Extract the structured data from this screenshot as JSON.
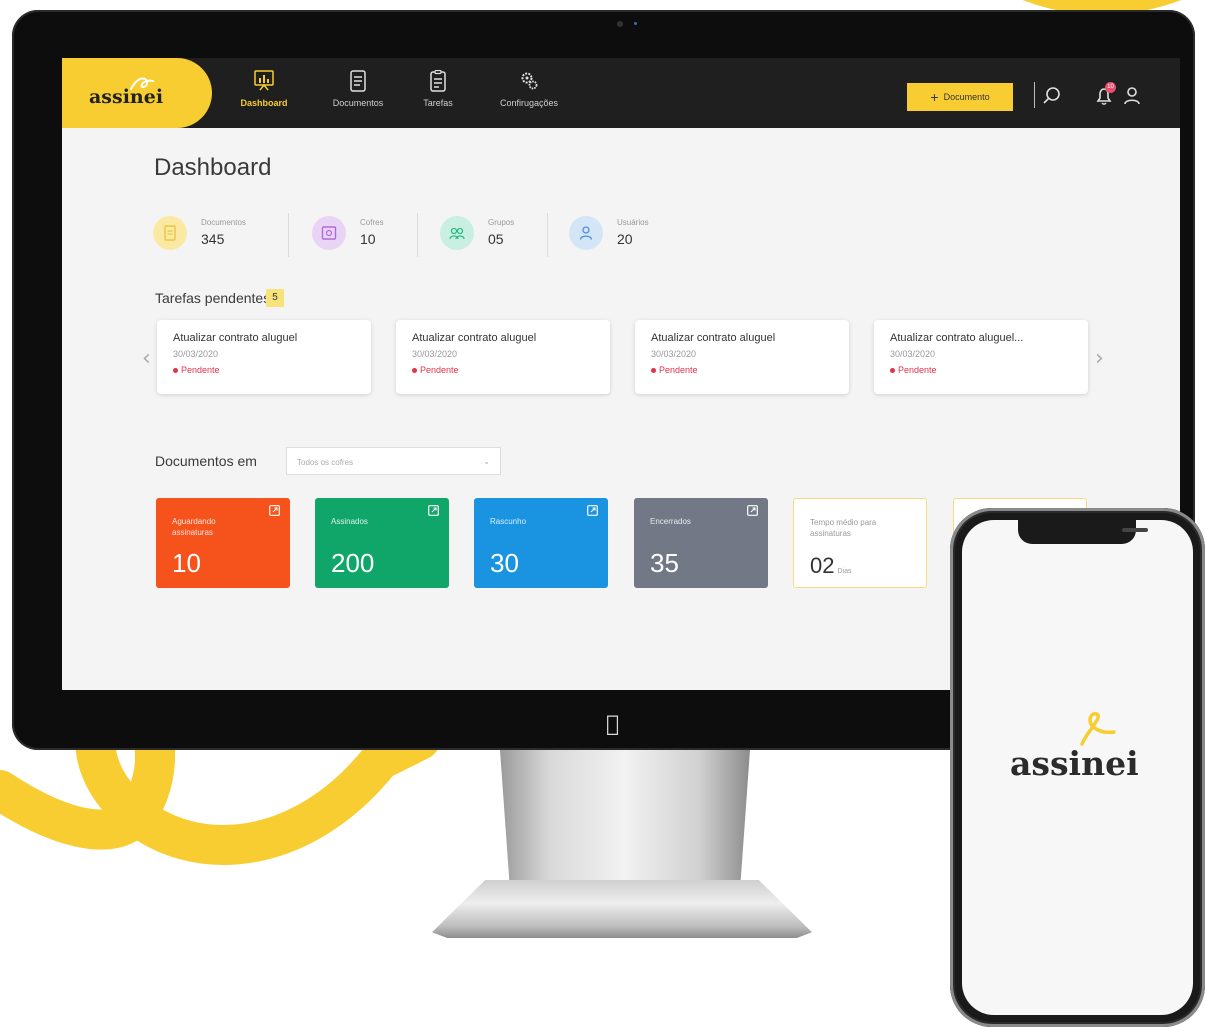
{
  "brand": {
    "name": "assinei",
    "accent": "#f8cd31"
  },
  "nav": {
    "items": [
      {
        "label": "Dashboard",
        "icon": "dashboard-icon",
        "active": true
      },
      {
        "label": "Documentos",
        "icon": "document-icon",
        "active": false
      },
      {
        "label": "Tarefas",
        "icon": "tasks-icon",
        "active": false
      },
      {
        "label": "Confirugações",
        "icon": "settings-gears-icon",
        "active": false
      }
    ],
    "new_document_label": "Documento",
    "notification_count": "10"
  },
  "dashboard": {
    "title": "Dashboard",
    "stats": [
      {
        "label": "Documentos",
        "value": "345",
        "icon": "document-icon",
        "color": "#fbe9a3"
      },
      {
        "label": "Cofres",
        "value": "10",
        "icon": "vault-icon",
        "color": "#e8d3f5"
      },
      {
        "label": "Grupos",
        "value": "05",
        "icon": "group-icon",
        "color": "#c9efe2"
      },
      {
        "label": "Usuários",
        "value": "20",
        "icon": "user-icon",
        "color": "#d4e5f8"
      }
    ],
    "pending": {
      "title": "Tarefas pendentes",
      "count": "5",
      "tasks": [
        {
          "title": "Atualizar contrato aluguel",
          "date": "30/03/2020",
          "status": "Pendente"
        },
        {
          "title": "Atualizar contrato aluguel",
          "date": "30/03/2020",
          "status": "Pendente"
        },
        {
          "title": "Atualizar contrato aluguel",
          "date": "30/03/2020",
          "status": "Pendente"
        },
        {
          "title": "Atualizar contrato aluguel...",
          "date": "30/03/2020",
          "status": "Pendente"
        }
      ]
    },
    "documents": {
      "title": "Documentos em",
      "filter_value": "Todos os cofres",
      "cards": [
        {
          "label": "Aguardando assinaturas",
          "value": "10",
          "color": "#f5521c"
        },
        {
          "label": "Assinados",
          "value": "200",
          "color": "#10a66a"
        },
        {
          "label": "Rascunho",
          "value": "30",
          "color": "#1a94e0"
        },
        {
          "label": "Encerrados",
          "value": "35",
          "color": "#727885"
        }
      ],
      "average_time": {
        "label": "Tempo médio para assinaturas",
        "value": "02",
        "unit": "Dias"
      }
    }
  },
  "phone": {
    "logo": "assinei"
  }
}
